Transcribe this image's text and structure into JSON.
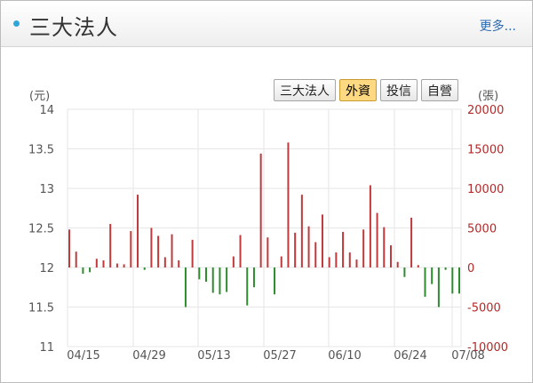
{
  "header": {
    "title": "三大法人",
    "more": "更多..."
  },
  "tabs": [
    {
      "label": "三大法人",
      "active": false
    },
    {
      "label": "外資",
      "active": true
    },
    {
      "label": "投信",
      "active": false
    },
    {
      "label": "自營",
      "active": false
    }
  ],
  "units": {
    "left": "(元)",
    "right": "(張)"
  },
  "chart_data": {
    "type": "bar",
    "left_axis": {
      "ticks": [
        "14",
        "13.5",
        "13",
        "12.5",
        "12",
        "11.5",
        "11"
      ],
      "range": [
        11,
        14
      ]
    },
    "right_axis": {
      "ticks": [
        "20000",
        "15000",
        "10000",
        "5000",
        "0",
        "-5000",
        "-10000"
      ],
      "range": [
        -10000,
        20000
      ]
    },
    "x_ticks": [
      "04/15",
      "04/29",
      "05/13",
      "05/27",
      "06/10",
      "06/24",
      "07/08"
    ],
    "colors": {
      "positive": "#c0393b",
      "negative": "#2e8b2e"
    },
    "series": [
      {
        "values": [
          4800,
          2000,
          -800,
          -600,
          1100,
          900,
          5500,
          500,
          400,
          4600,
          9200,
          -300,
          5000,
          4000,
          1300,
          4200,
          900,
          -5000,
          3500,
          -1500,
          -1800,
          -3200,
          -3400,
          -3100,
          1400,
          4100,
          -4800,
          -2500,
          14400,
          3800,
          -3400,
          1400,
          15800,
          4400,
          9200,
          5200,
          3200,
          6700,
          1300,
          1900,
          4500,
          1900,
          1000,
          4800,
          10400,
          6900,
          5100,
          2800,
          700,
          -1200,
          6300,
          300,
          -3700,
          -2100,
          -5000,
          -300,
          -3300,
          -3300
        ]
      }
    ]
  }
}
